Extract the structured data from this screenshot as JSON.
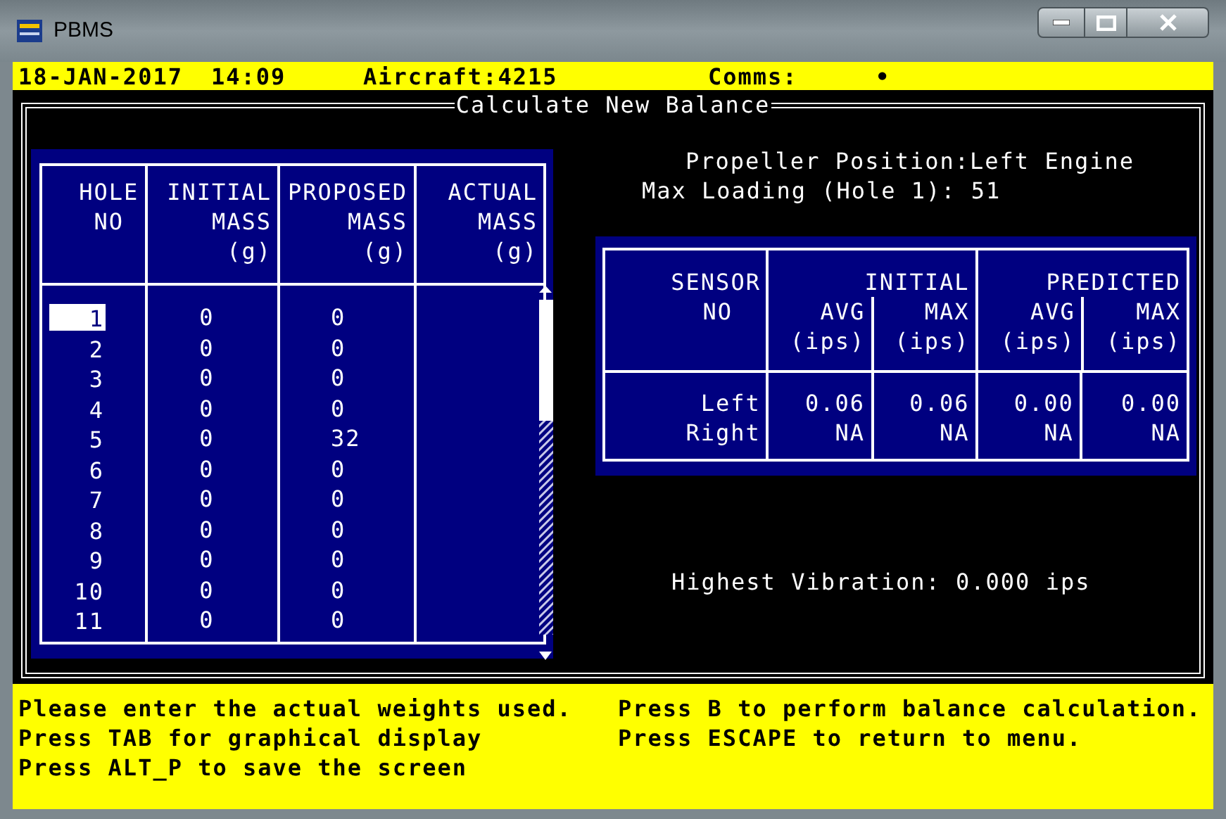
{
  "window": {
    "title": "PBMS"
  },
  "status_bar": {
    "date": "18-JAN-2017",
    "time": "14:09",
    "aircraft": "Aircraft:4215",
    "comms": "Comms:",
    "comms_indicator": "•"
  },
  "screen_title": "Calculate New Balance",
  "hole_table": {
    "columns": [
      {
        "lines": [
          "HOLE",
          "NO"
        ]
      },
      {
        "lines": [
          "INITIAL",
          "MASS",
          "(g)"
        ]
      },
      {
        "lines": [
          "PROPOSED",
          "MASS",
          "(g)"
        ]
      },
      {
        "lines": [
          "ACTUAL",
          "MASS",
          "(g)"
        ]
      }
    ],
    "rows": [
      {
        "hole": "1",
        "initial": "0",
        "proposed": "0",
        "selected": true
      },
      {
        "hole": "2",
        "initial": "0",
        "proposed": "0",
        "selected": false
      },
      {
        "hole": "3",
        "initial": "0",
        "proposed": "0",
        "selected": false
      },
      {
        "hole": "4",
        "initial": "0",
        "proposed": "0",
        "selected": false
      },
      {
        "hole": "5",
        "initial": "0",
        "proposed": "32",
        "selected": false
      },
      {
        "hole": "6",
        "initial": "0",
        "proposed": "0",
        "selected": false
      },
      {
        "hole": "7",
        "initial": "0",
        "proposed": "0",
        "selected": false
      },
      {
        "hole": "8",
        "initial": "0",
        "proposed": "0",
        "selected": false
      },
      {
        "hole": "9",
        "initial": "0",
        "proposed": "0",
        "selected": false
      },
      {
        "hole": "10",
        "initial": "0",
        "proposed": "0",
        "selected": false
      },
      {
        "hole": "11",
        "initial": "0",
        "proposed": "0",
        "selected": false
      }
    ]
  },
  "propeller_position": "Propeller Position:Left Engine",
  "max_loading": "Max Loading (Hole 1): 51",
  "sensor_table": {
    "sensor_header": [
      "SENSOR",
      "NO"
    ],
    "groups": [
      {
        "title": "INITIAL",
        "columns": [
          [
            "AVG",
            "(ips)"
          ],
          [
            "MAX",
            "(ips)"
          ]
        ]
      },
      {
        "title": "PREDICTED",
        "columns": [
          [
            "AVG",
            "(ips)"
          ],
          [
            "MAX",
            "(ips)"
          ]
        ]
      }
    ],
    "sensors": [
      "Left",
      "Right"
    ],
    "values": [
      [
        "0.06",
        "NA"
      ],
      [
        "0.06",
        "NA"
      ],
      [
        "0.00",
        "NA"
      ],
      [
        "0.00",
        "NA"
      ]
    ]
  },
  "highest_vibration": "Highest Vibration: 0.000 ips",
  "help": {
    "left": [
      "Please enter the actual weights used.",
      "Press TAB for graphical display",
      "Press ALT_P to save the screen"
    ],
    "right": [
      "Press B to perform balance calculation.",
      "Press ESCAPE to return to menu."
    ]
  }
}
